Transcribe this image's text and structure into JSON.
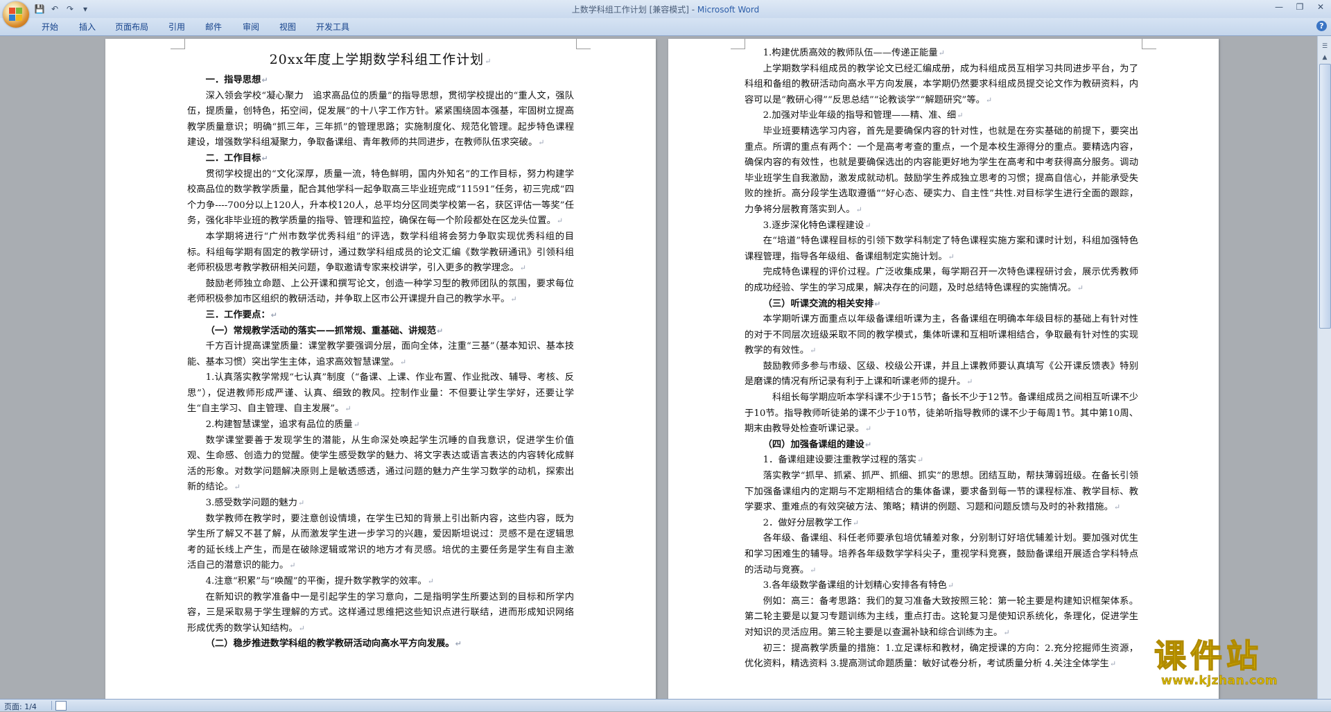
{
  "window": {
    "title": "上数学科组工作计划 [兼容模式] - ",
    "app_name": "Microsoft Word"
  },
  "quick_access": {
    "save": "💾",
    "undo": "↶",
    "redo": "↷",
    "customize": "▾"
  },
  "ribbon_tabs": [
    "开始",
    "插入",
    "页面布局",
    "引用",
    "邮件",
    "审阅",
    "视图",
    "开发工具"
  ],
  "status_bar": {
    "page_count": "页面: 1/4"
  },
  "watermark": {
    "cn": "课件站",
    "url": "www.kjzhan.com"
  },
  "page1": [
    {
      "type": "h1",
      "text": "20xx年度上学期数学科组工作计划"
    },
    {
      "type": "h2",
      "text": "一．指导思想"
    },
    {
      "type": "p",
      "text": "深入领会学校“凝心聚力　追求高品位的质量”的指导思想，贯彻学校提出的“重人文，强队伍，提质量，创特色，拓空间，促发展”的十八字工作方针。紧紧围绕固本强基，牢固树立提高教学质量意识；明确“抓三年，三年抓”的管理思路；实施制度化、规范化管理。起步特色课程建设，增强数学科组凝聚力，争取备课组、青年教师的共同进步，在教师队伍求突破。"
    },
    {
      "type": "h2",
      "text": "二．工作目标"
    },
    {
      "type": "p",
      "text": "贯彻学校提出的“文化深厚，质量一流，特色鲜明，国内外知名”的工作目标，努力构建学校高品位的数学教学质量，配合其他学科一起争取高三毕业班完成“11591”任务，初三完成“四个力争----700分以上120人，升本校120人，总平均分区同类学校第一名，获区评估一等奖”任务，强化非毕业班的教学质量的指导、管理和监控，确保在每一个阶段都处在区龙头位置。"
    },
    {
      "type": "p",
      "text": "本学期将进行“广州市数学优秀科组”的评选，数学科组将会努力争取实现优秀科组的目标。科组每学期有固定的教学研讨，通过数学科组成员的论文汇编《数学教研通讯》引领科组老师积极思考教学教研相关问题，争取邀请专家来校讲学，引入更多的教学理念。"
    },
    {
      "type": "p",
      "text": "鼓励老师独立命题、上公开课和撰写论文，创造一种学习型的教师团队的氛围，要求每位老师积极参加市区组织的教研活动，并争取上区市公开课提升自己的教学水平。"
    },
    {
      "type": "h2",
      "text": "三．工作要点："
    },
    {
      "type": "bold",
      "text": "（一）常规教学活动的落实——抓常规、重基础、讲规范"
    },
    {
      "type": "p",
      "text": "千方百计提高课堂质量：课堂教学要强调分层，面向全体，注重“三基”（基本知识、基本技能、基本习惯）突出学生主体，追求高效智慧课堂。"
    },
    {
      "type": "p",
      "text": "1.认真落实教学常规“七认真”制度（“备课、上课、作业布置、作业批改、辅导、考核、反思”），促进教师形成严谨、认真、细致的教风。控制作业量：不但要让学生学好，还要让学生“自主学习、自主管理、自主发展”。"
    },
    {
      "type": "p",
      "text": "2.构建智慧课堂，追求有品位的质量"
    },
    {
      "type": "p",
      "text": "数学课堂要善于发现学生的潜能，从生命深处唤起学生沉睡的自我意识，促进学生价值观、生命感、创造力的觉醒。使学生感受数学的魅力、将文字表达或语言表达的内容转化成鲜活的形象。对数学问题解决原则上是敏透感透，通过问题的魅力产生学习数学的动机，探索出新的结论。"
    },
    {
      "type": "p",
      "text": "3.感受数学问题的魅力"
    },
    {
      "type": "p",
      "text": "数学教师在教学时，要注意创设情境，在学生已知的背景上引出新内容，这些内容，既为学生所了解又不甚了解，从而激发学生进一步学习的兴趣，爱因斯坦说过：灵感不是在逻辑思考的延长线上产生，而是在破除逻辑或常识的地方才有灵感。培优的主要任务是学生有自主激活自己的潜意识的能力。"
    },
    {
      "type": "p",
      "text": "4.注意“积累”与“唤醒”的平衡，提升数学教学的效率。"
    },
    {
      "type": "p",
      "text": "在新知识的教学准备中一是引起学生的学习意向，二是指明学生所要达到的目标和所学内容，三是采取易于学生理解的方式。这样通过思维把这些知识点进行联结，进而形成知识网络形成优秀的数学认知结构。"
    },
    {
      "type": "bold",
      "text": "（二）稳步推进数学科组的教学教研活动向高水平方向发展。"
    }
  ],
  "page2": [
    {
      "type": "p",
      "text": "1.构建优质高效的教师队伍——传递正能量"
    },
    {
      "type": "p",
      "text": "上学期数学科组成员的教学论文已经汇编成册，成为科组成员互相学习共同进步平台，为了科组和备组的教研活动向高水平方向发展，本学期仍然要求科组成员提交论文作为教研资料，内容可以是“教研心得”“反思总结”“论教谈学”“解题研究”等。"
    },
    {
      "type": "p",
      "text": "2.加强对毕业年级的指导和管理——精、准、细"
    },
    {
      "type": "p",
      "text": "毕业班要精选学习内容，首先是要确保内容的针对性，也就是在夯实基础的前提下，要突出重点。所谓的重点有两个：一个是高考考查的重点，一个是本校生源得分的重点。要精选内容，确保内容的有效性，也就是要确保选出的内容能更好地为学生在高考和中考获得高分服务。调动毕业班学生自我激励，激发成就动机。鼓励学生养成独立思考的习惯；提高自信心，并能承受失败的挫折。高分段学生选取遵循“”好心态、硬实力、自主性”共性.对目标学生进行全面的跟踪，力争将分层教育落实到人。"
    },
    {
      "type": "p",
      "text": "3.逐步深化特色课程建设"
    },
    {
      "type": "p",
      "text": "在“培道”特色课程目标的引领下数学科制定了特色课程实施方案和课时计划，科组加强特色课程管理，指导各年级组、备课组制定实施计划。"
    },
    {
      "type": "p",
      "text": "完成特色课程的评价过程。广泛收集成果，每学期召开一次特色课程研讨会，展示优秀教师的成功经验、学生的学习成果，解决存在的问题，及时总结特色课程的实施情况。"
    },
    {
      "type": "bold",
      "text": "（三）听课交流的相关安排"
    },
    {
      "type": "p",
      "text": "本学期听课方面重点以年级备课组听课为主，各备课组在明确本年级目标的基础上有针对性的对于不同层次班级采取不同的教学模式，集体听课和互相听课相结合，争取最有针对性的实现教学的有效性。"
    },
    {
      "type": "p",
      "text": "鼓励教师多参与市级、区级、校级公开课，并且上课教师要认真填写《公开课反馈表》特别是磨课的情况有所记录有利于上课和听课老师的提升。"
    },
    {
      "type": "p",
      "text": "　科组长每学期应听本学科课不少于15节；备长不少于12节。备课组成员之间相互听课不少于10节。指导教师听徒弟的课不少于10节，徒弟听指导教师的课不少于每周1节。其中第10周、期末由教导处检查听课记录。"
    },
    {
      "type": "bold",
      "text": "（四）加强备课组的建设"
    },
    {
      "type": "p",
      "text": "1．备课组建设要注重教学过程的落实"
    },
    {
      "type": "p",
      "text": "落实教学“抓早、抓紧、抓严、抓细、抓实”的思想。团结互助，帮扶薄弱班级。在备长引领下加强备课组内的定期与不定期相结合的集体备课，要求备到每一节的课程标准、教学目标、教学要求、重难点的有效突破方法、策略；精讲的例题、习题和问题反馈与及时的补救措施。"
    },
    {
      "type": "p",
      "text": "2．做好分层教学工作"
    },
    {
      "type": "p",
      "text": "各年级、备课组、科任老师要承包培优辅差对象，分别制订好培优辅差计划。要加强对优生和学习困难生的辅导。培养各年级数学学科尖子，重视学科竞赛，鼓励备课组开展适合学科特点的活动与竞赛。"
    },
    {
      "type": "p",
      "text": "3.各年级数学备课组的计划精心安排各有特色"
    },
    {
      "type": "p",
      "text": "例如：高三：备考思路：我们的复习准备大致按照三轮：第一轮主要是构建知识框架体系。第二轮主要是以复习专题训练为主线，重点打击。这轮复习是使知识系统化，条理化，促进学生对知识的灵活应用。第三轮主要是以查漏补缺和综合训练为主。"
    },
    {
      "type": "p",
      "text": "初三：提高教学质量的措施：1.立足课标和教材，确定授课的方向：2.充分挖掘师生资源，优化资料，精选资料 3.提高测试命题质量：敏好试卷分析，考试质量分析 4.关注全体学生"
    }
  ]
}
